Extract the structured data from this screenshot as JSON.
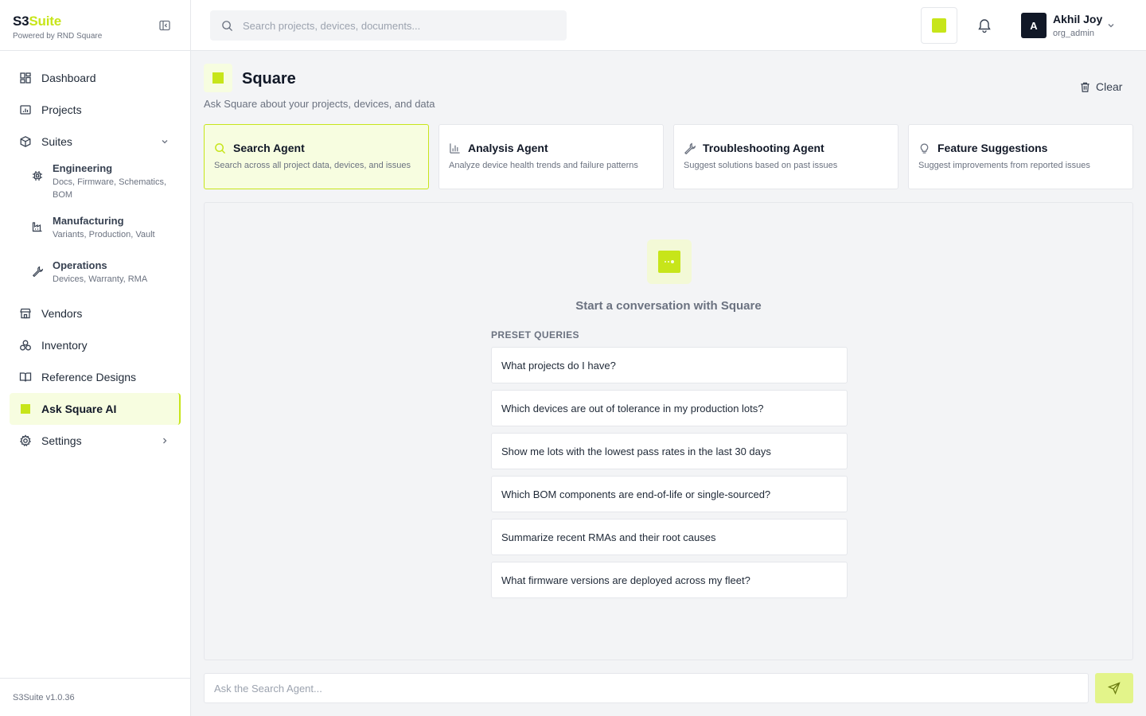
{
  "brand": {
    "name_main": "S3",
    "name_accent": "Suite",
    "subtitle": "Powered by RND Square"
  },
  "sidebar": {
    "items": [
      {
        "label": "Dashboard",
        "icon": "dashboard-icon"
      },
      {
        "label": "Projects",
        "icon": "projects-icon"
      },
      {
        "label": "Suites",
        "icon": "cube-icon",
        "expanded": true
      },
      {
        "label": "Vendors",
        "icon": "store-icon"
      },
      {
        "label": "Inventory",
        "icon": "boxes-icon"
      },
      {
        "label": "Reference Designs",
        "icon": "book-icon"
      },
      {
        "label": "Ask Square AI",
        "icon": "ai-square-icon",
        "active": true
      },
      {
        "label": "Settings",
        "icon": "gear-icon"
      }
    ],
    "suites": [
      {
        "title": "Engineering",
        "desc": "Docs, Firmware, Schematics, BOM",
        "icon": "chip-icon"
      },
      {
        "title": "Manufacturing",
        "desc": "Variants, Production, Vault",
        "icon": "factory-icon"
      },
      {
        "title": "Operations",
        "desc": "Devices, Warranty, RMA",
        "icon": "wrench-icon"
      }
    ],
    "version": "S3Suite v1.0.36"
  },
  "topbar": {
    "search_placeholder": "Search projects, devices, documents...",
    "user": {
      "initial": "A",
      "name": "Akhil Joy",
      "role": "org_admin"
    }
  },
  "main": {
    "title": "Square",
    "subtitle": "Ask Square about your projects, devices, and data",
    "clear_label": "Clear",
    "agents": [
      {
        "title": "Search Agent",
        "desc": "Search across all project data, devices, and issues",
        "icon": "search-icon",
        "active": true
      },
      {
        "title": "Analysis Agent",
        "desc": "Analyze device health trends and failure patterns",
        "icon": "bar-chart-icon"
      },
      {
        "title": "Troubleshooting Agent",
        "desc": "Suggest solutions based on past issues",
        "icon": "wrench-icon"
      },
      {
        "title": "Feature Suggestions",
        "desc": "Suggest improvements from reported issues",
        "icon": "lightbulb-icon"
      }
    ],
    "chat": {
      "empty_title": "Start a conversation with Square",
      "preset_label": "PRESET QUERIES",
      "presets": [
        "What projects do I have?",
        "Which devices are out of tolerance in my production lots?",
        "Show me lots with the lowest pass rates in the last 30 days",
        "Which BOM components are end-of-life or single-sourced?",
        "Summarize recent RMAs and their root causes",
        "What firmware versions are deployed across my fleet?"
      ]
    },
    "composer_placeholder": "Ask the Search Agent..."
  },
  "colors": {
    "accent": "#c7e51a",
    "accent_light": "#f7fde0",
    "dark": "#111827"
  }
}
